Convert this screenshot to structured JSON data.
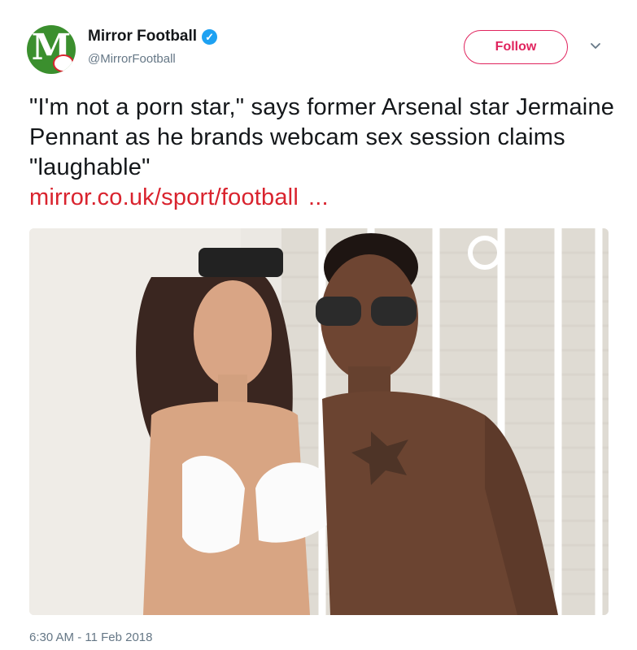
{
  "author": {
    "display_name": "Mirror Football",
    "handle": "@MirrorFootball",
    "avatar_letter": "M",
    "avatar_color": "#3b8f2e",
    "verified_icon": "verified-badge-icon",
    "verified_color": "#1da1f2"
  },
  "follow_button": {
    "label": "Follow",
    "color": "#e0245e"
  },
  "menu_icon": "chevron-down-icon",
  "tweet": {
    "text": "\"I'm not a porn star,\" says former Arsenal star Jermaine Pennant as he brands webcam sex session claims \"laughable\"",
    "link_text": "mirror.co.uk/sport/football",
    "link_ellipsis": "...",
    "link_color": "#d9232e"
  },
  "media": {
    "type": "photo"
  },
  "timestamp": "6:30 AM - 11 Feb 2018"
}
